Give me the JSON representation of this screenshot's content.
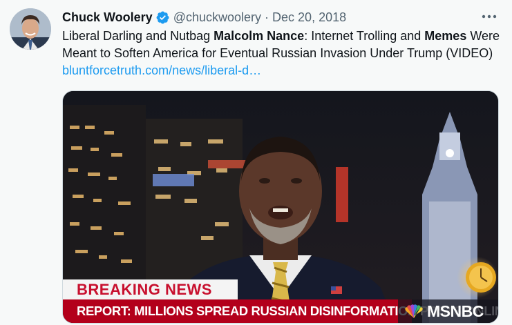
{
  "tweet": {
    "author_name": "Chuck Woolery",
    "handle": "@chuckwoolery",
    "separator": "·",
    "date": "Dec 20, 2018",
    "text": {
      "part1": "Liberal Darling and Nutbag ",
      "bold1": "Malcolm Nance",
      "part2": ": Internet Trolling and ",
      "bold2": "Memes",
      "part3": " Were Meant to Soften America for Eventual Russian Invasion Under Trump (VIDEO) ",
      "link": "bluntforcetruth.com/news/liberal-d…"
    },
    "verified_icon": "verified-badge-icon",
    "more_icon": "more-options-icon"
  },
  "media": {
    "lower_third_label": "BREAKING NEWS",
    "headline": "REPORT: MILLIONS SPREAD RUSSIAN DISINFORMATION POSTS ONLINE",
    "network": "MSNBC",
    "network_icon": "peacock-logo-icon"
  },
  "colors": {
    "background": "#f7f9f9",
    "link": "#1d9bf0",
    "verified": "#1d9bf0",
    "secondary_text": "#536471",
    "breaking_red": "#b3001b"
  }
}
